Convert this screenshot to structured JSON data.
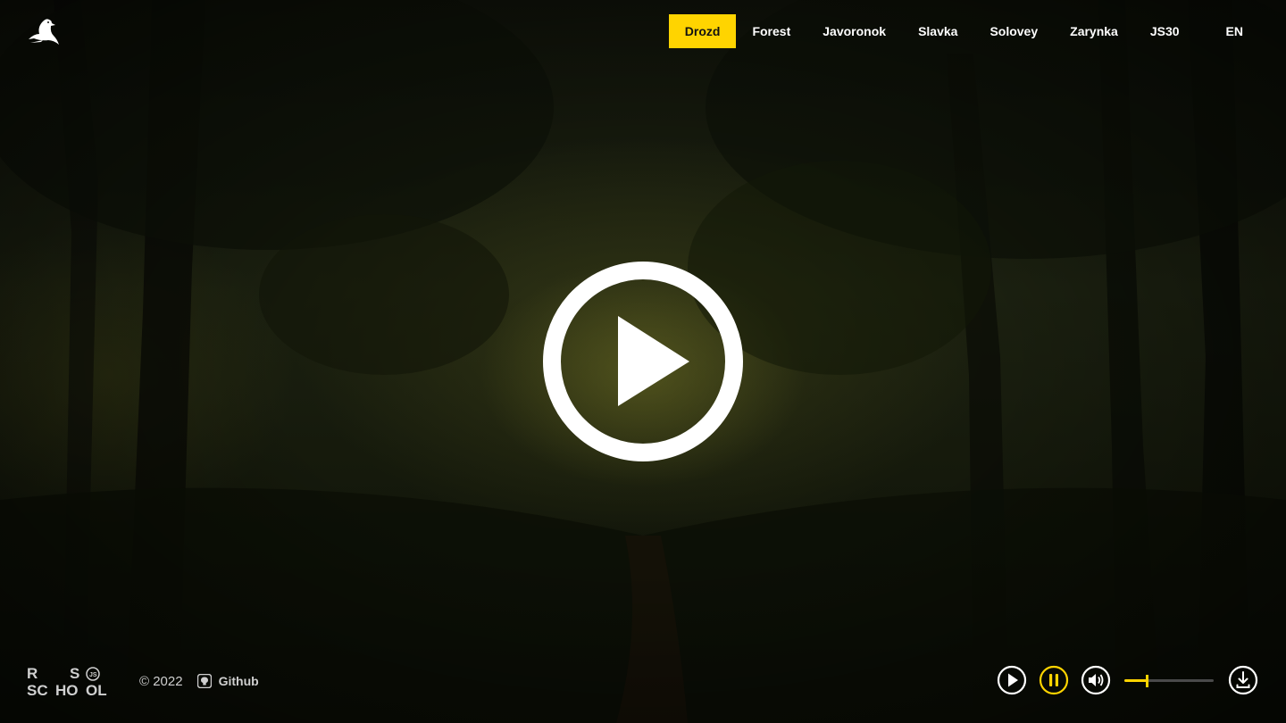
{
  "nav": {
    "items": [
      {
        "label": "Drozd",
        "active": true
      },
      {
        "label": "Forest",
        "active": false
      },
      {
        "label": "Javoronok",
        "active": false
      },
      {
        "label": "Slavka",
        "active": false
      },
      {
        "label": "Solovey",
        "active": false
      },
      {
        "label": "Zarynka",
        "active": false
      },
      {
        "label": "JS30",
        "active": false
      }
    ],
    "language": "EN"
  },
  "hero": {
    "play_icon": "play-circle-icon"
  },
  "footer": {
    "school_logo_text": "RS SCHOOL JS",
    "copyright": "© 2022",
    "github_label": "Github"
  },
  "player": {
    "volume": 0.25,
    "icons": [
      "play-icon",
      "pause-icon",
      "volume-icon",
      "download-icon"
    ]
  },
  "colors": {
    "accent": "#ffd400",
    "text": "#ffffff",
    "muted": "#cfcfcf"
  }
}
